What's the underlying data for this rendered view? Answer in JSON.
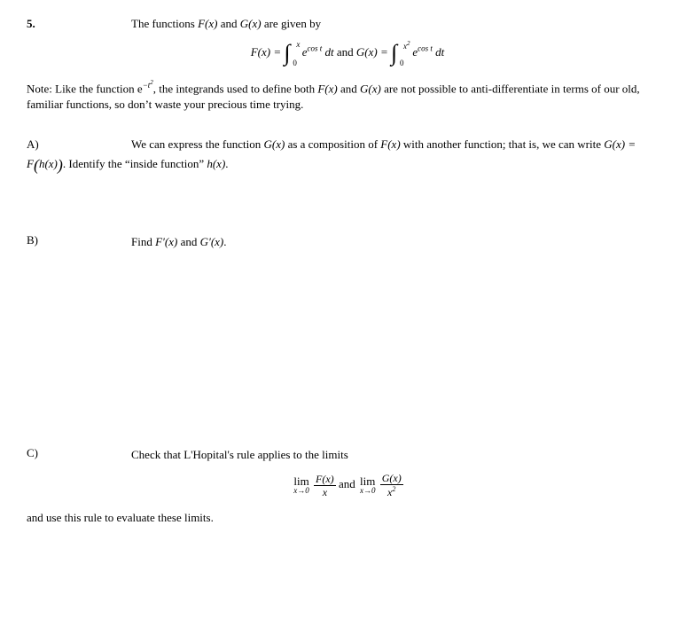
{
  "problem": {
    "number": "5.",
    "intro": "The functions F(x) and G(x) are given by",
    "equation_F_lhs": "F(x) = ",
    "equation_F_upper": "x",
    "equation_F_lower": "0",
    "equation_integrand": "e",
    "equation_exponent": "cos t",
    "equation_dt": " dt",
    "equation_and": "   and   ",
    "equation_G_lhs": "G(x) = ",
    "equation_G_upper": "x",
    "equation_G_upper_exp": "2",
    "equation_G_lower": "0",
    "note": "Note: Like the function e",
    "note_exp": "−t",
    "note_exp2": "2",
    "note_rest": ", the integrands used to define both F(x) and G(x) are not possible to anti-differentiate in terms of our old, familiar functions, so don't waste your precious time trying."
  },
  "partA": {
    "label": "A)",
    "line1_left": "We can express the function G(x) as a composition of F(x) with another function; that is, we can write",
    "line2_prefix": "G(x) = F",
    "line2_h": "h(x)",
    "line2_suffix": ". Identify the “inside function” h(x)."
  },
  "partB": {
    "label": "B)",
    "content": "Find F′(x) and G′(x)."
  },
  "partC": {
    "label": "C)",
    "content": "Check that L'Hopital's rule applies to the limits",
    "lim_label": "lim",
    "lim_sub": "x→0",
    "frac1_num": "F(x)",
    "frac1_den": "x",
    "and": "   and   ",
    "frac2_num": "G(x)",
    "frac2_den_base": "x",
    "frac2_den_exp": "2",
    "closing": "and use this rule to evaluate these limits."
  }
}
